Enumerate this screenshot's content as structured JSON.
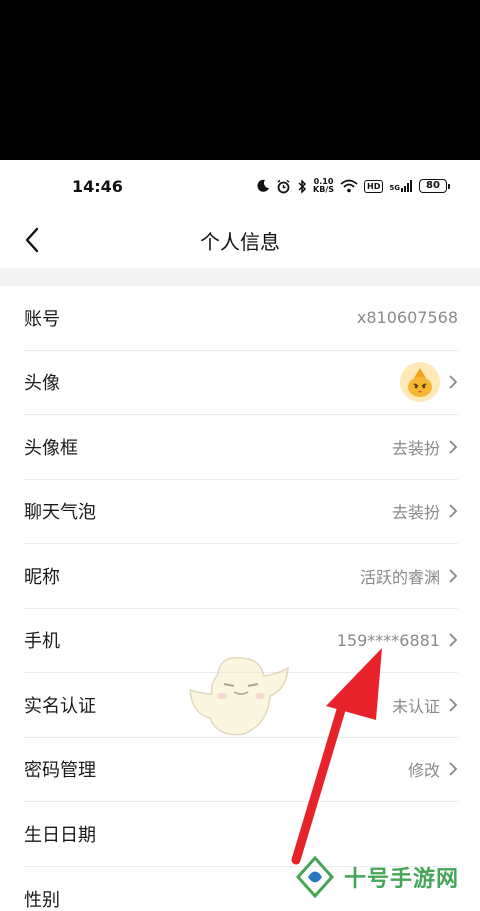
{
  "status_bar": {
    "time": "14:46",
    "net_speed_value": "0.10",
    "net_speed_unit": "KB/S",
    "hd_label": "HD",
    "network_label": "5G",
    "battery": "80"
  },
  "header": {
    "title": "个人信息"
  },
  "items": [
    {
      "label": "账号",
      "value": "x810607568",
      "has_chevron": false
    },
    {
      "label": "头像",
      "value": "",
      "has_chevron": true,
      "avatar": true
    },
    {
      "label": "头像框",
      "value": "去装扮",
      "has_chevron": true
    },
    {
      "label": "聊天气泡",
      "value": "去装扮",
      "has_chevron": true
    },
    {
      "label": "昵称",
      "value": "活跃的睿渊",
      "has_chevron": true
    },
    {
      "label": "手机",
      "value": "159****6881",
      "has_chevron": true
    },
    {
      "label": "实名认证",
      "value": "未认证",
      "has_chevron": true
    },
    {
      "label": "密码管理",
      "value": "修改",
      "has_chevron": true
    },
    {
      "label": "生日日期",
      "value": "",
      "has_chevron": false
    },
    {
      "label": "性别",
      "value": "",
      "has_chevron": false
    }
  ],
  "watermark": {
    "text": "十号手游网"
  },
  "colors": {
    "arrow": "#e8222a",
    "watermark": "#3aa14d",
    "value_text": "#8a8a8a"
  }
}
